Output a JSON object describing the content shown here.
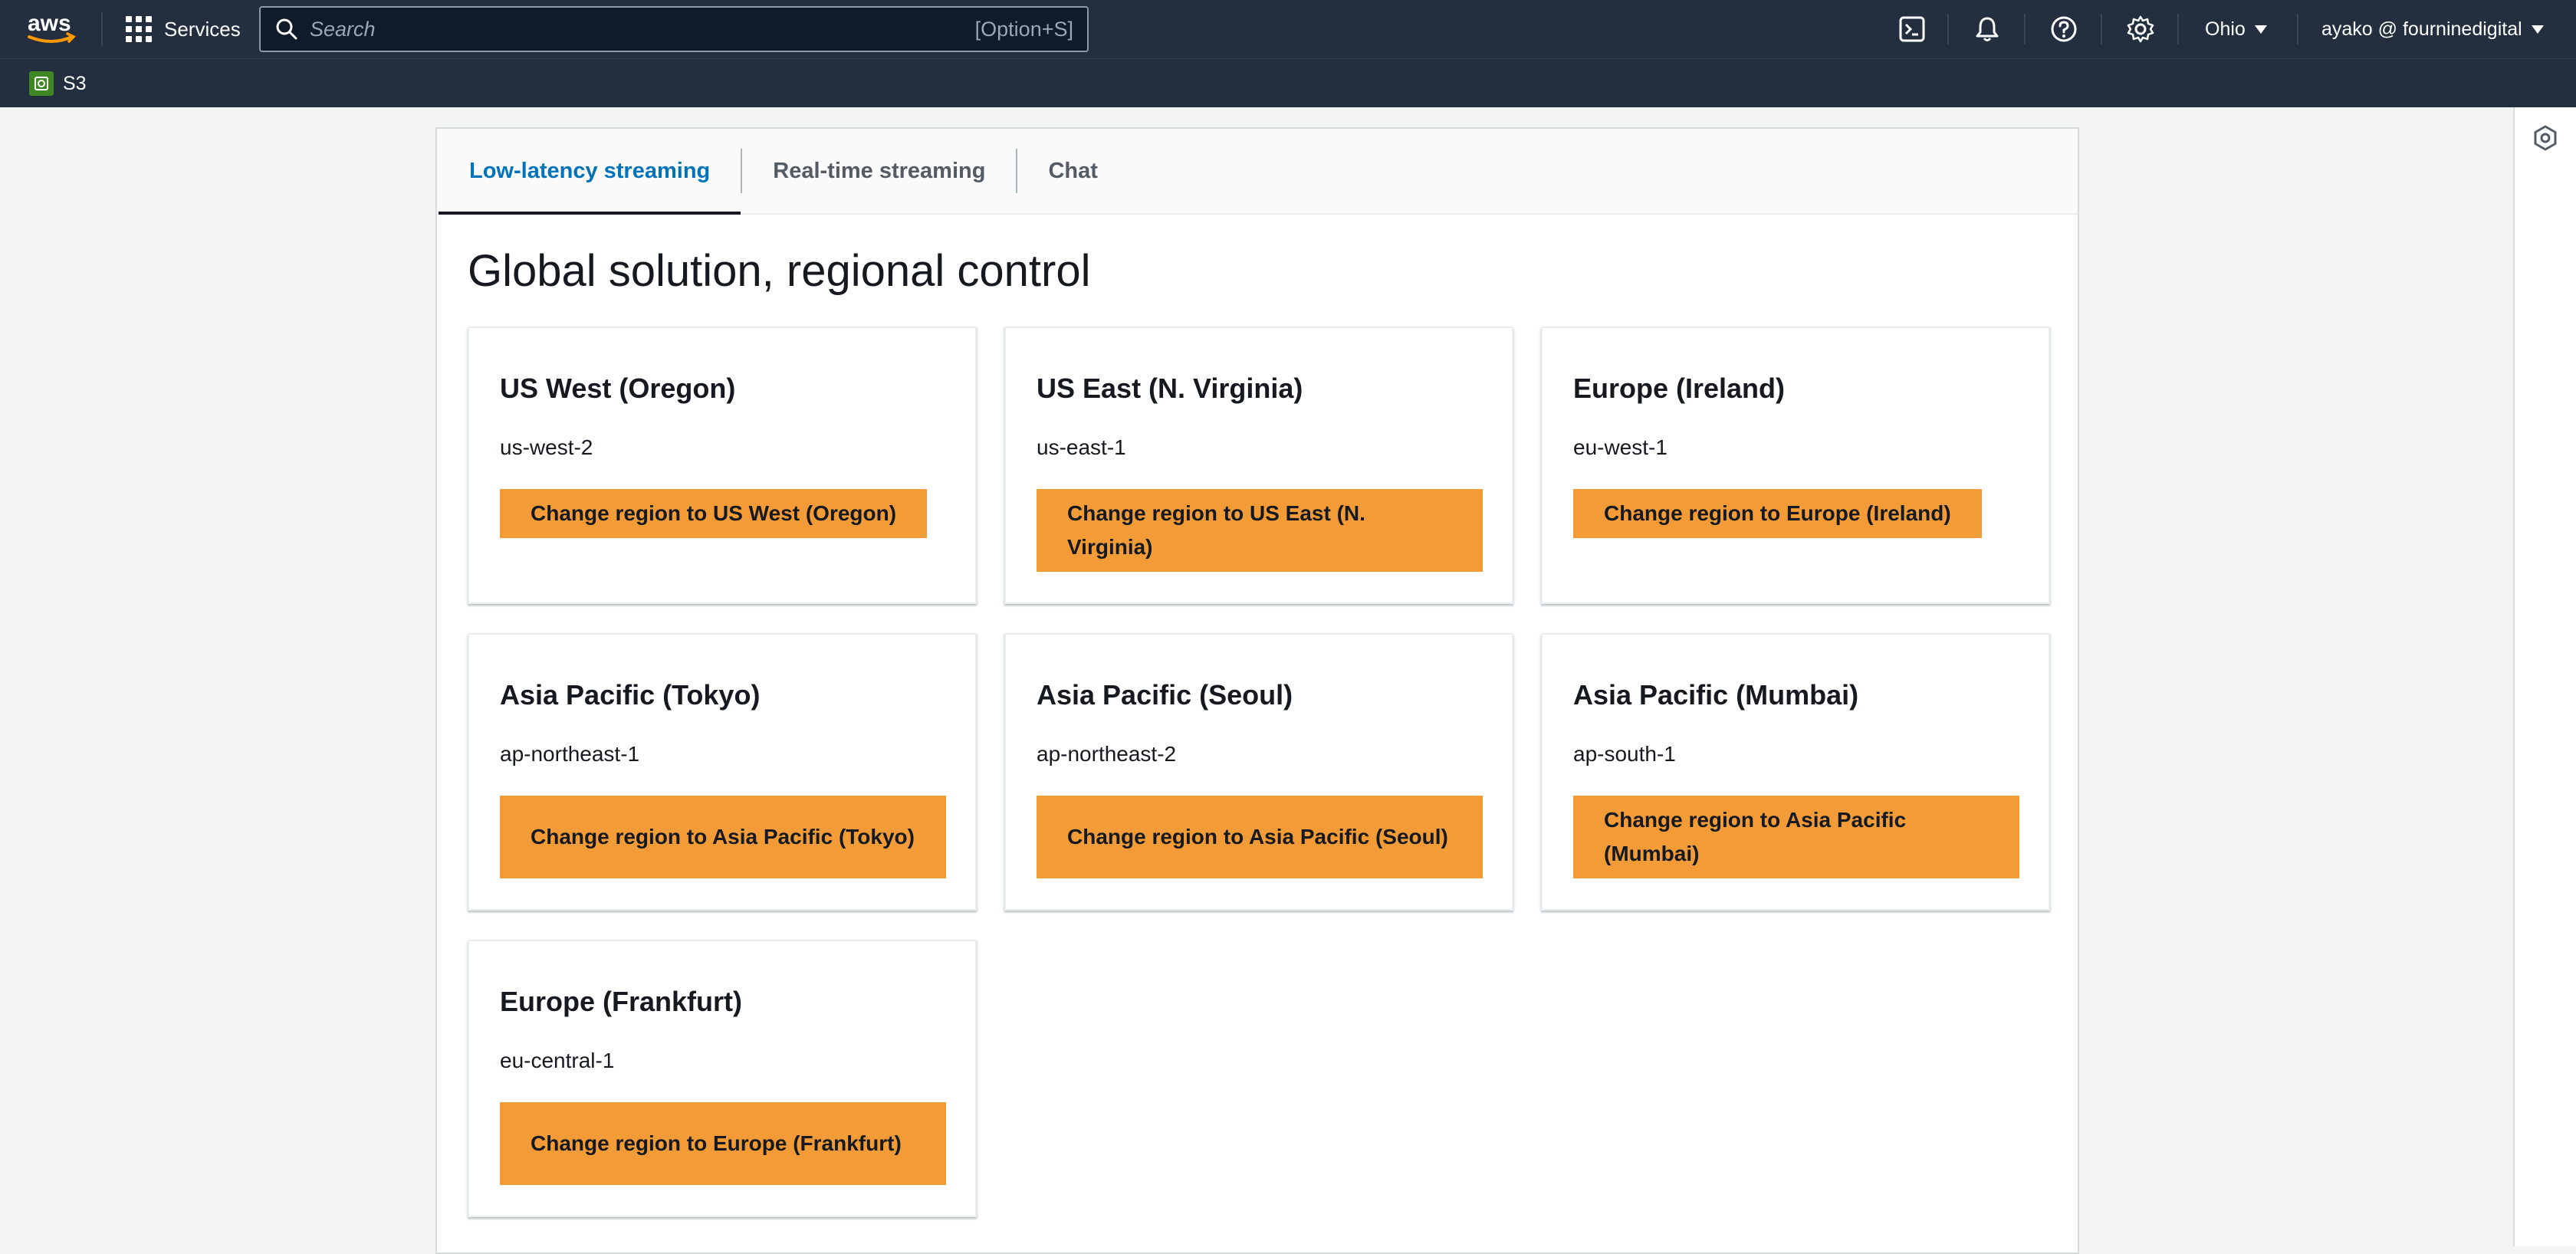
{
  "topnav": {
    "logo_text": "aws",
    "services_label": "Services",
    "search_placeholder": "Search",
    "search_shortcut": "[Option+S]",
    "region": "Ohio",
    "account": "ayako @ fourninedigital"
  },
  "favorites": {
    "s3_label": "S3"
  },
  "tabs": [
    {
      "label": "Low-latency streaming",
      "active": true
    },
    {
      "label": "Real-time streaming",
      "active": false
    },
    {
      "label": "Chat",
      "active": false
    }
  ],
  "section_title": "Global solution, regional control",
  "regions": [
    {
      "name": "US West (Oregon)",
      "code": "us-west-2",
      "button": "Change region to US West (Oregon)"
    },
    {
      "name": "US East (N. Virginia)",
      "code": "us-east-1",
      "button": "Change region to US East (N. Virginia)"
    },
    {
      "name": "Europe (Ireland)",
      "code": "eu-west-1",
      "button": "Change region to Europe (Ireland)"
    },
    {
      "name": "Asia Pacific (Tokyo)",
      "code": "ap-northeast-1",
      "button": "Change region to Asia Pacific (Tokyo)"
    },
    {
      "name": "Asia Pacific (Seoul)",
      "code": "ap-northeast-2",
      "button": "Change region to Asia Pacific (Seoul)"
    },
    {
      "name": "Asia Pacific (Mumbai)",
      "code": "ap-south-1",
      "button": "Change region to Asia Pacific (Mumbai)"
    },
    {
      "name": "Europe (Frankfurt)",
      "code": "eu-central-1",
      "button": "Change region to Europe (Frankfurt)"
    }
  ],
  "colors": {
    "nav_bg": "#232f3e",
    "accent_tab": "#0073bb",
    "button_bg": "#f39c37",
    "s3_icon": "#3f8624"
  }
}
